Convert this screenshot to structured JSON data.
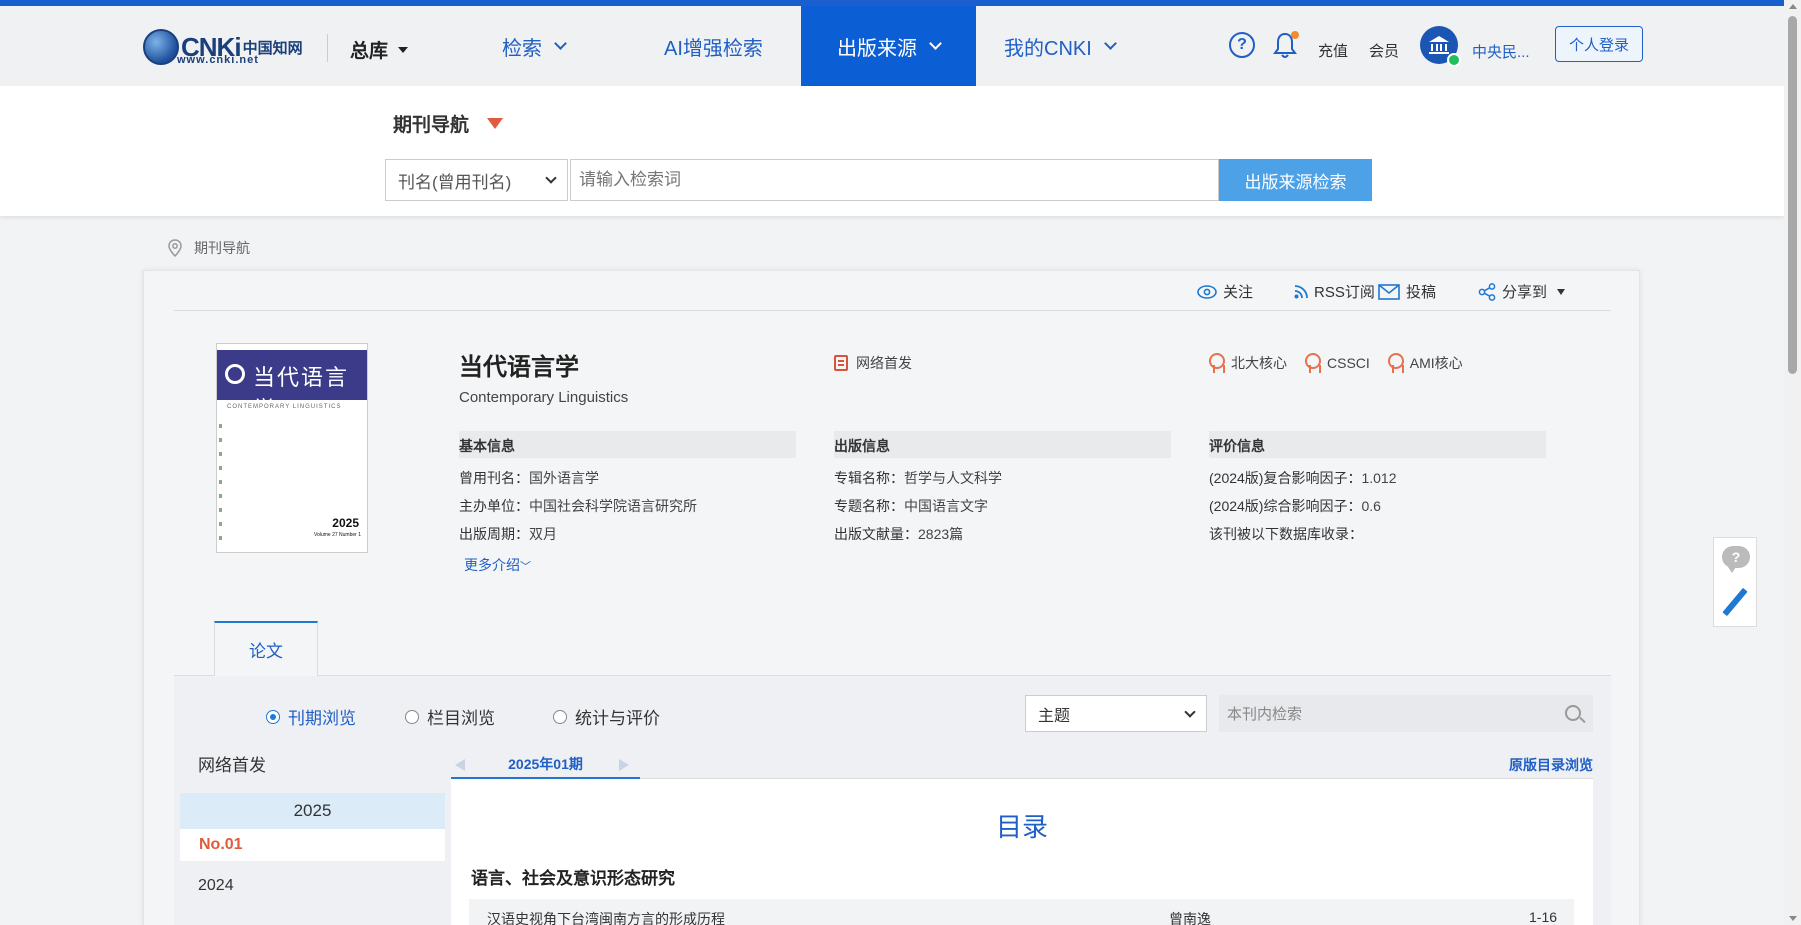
{
  "header": {
    "logo_text": "CNKi",
    "logo_cn": "中国知网",
    "logo_sub": "www.cnki.net",
    "library": "总库",
    "nav": [
      {
        "label": "检索"
      },
      {
        "label": "AI增强检索"
      },
      {
        "label": "出版来源"
      },
      {
        "label": "我的CNKI"
      }
    ],
    "recharge": "充值",
    "member": "会员",
    "institution": "中央民...",
    "login": "个人登录",
    "help_glyph": "?",
    "colors": {
      "accent": "#1a5fd0",
      "nav_active": "#0b5ed4",
      "link": "#1f5fc6",
      "highlight": "#e05a3c"
    }
  },
  "search": {
    "nav_title": "期刊导航",
    "field_select": "刊名(曾用刊名)",
    "placeholder": "请输入检索词",
    "button": "出版来源检索"
  },
  "breadcrumb": {
    "current": "期刊导航"
  },
  "toolbar": {
    "follow": "关注",
    "rss": "RSS订阅",
    "submit": "投稿",
    "share": "分享到"
  },
  "journal": {
    "title": "当代语言学",
    "title_en": "Contemporary Linguistics",
    "online_first": "网络首发",
    "badges": [
      "北大核心",
      "CSSCI",
      "AMI核心"
    ],
    "cover": {
      "title": "当代语言学",
      "sub": "CONTEMPORARY LINGUISTICS",
      "year": "2025",
      "vol": "Volume 27  Number 1"
    },
    "basic": {
      "heading": "基本信息",
      "rows": [
        {
          "label": "曾用刊名：",
          "value": "国外语言学"
        },
        {
          "label": "主办单位：",
          "value": "中国社会科学院语言研究所"
        },
        {
          "label": "出版周期：",
          "value": "双月"
        }
      ]
    },
    "publish": {
      "heading": "出版信息",
      "rows": [
        {
          "label": "专辑名称：",
          "value": "哲学与人文科学"
        },
        {
          "label": "专题名称：",
          "value": "中国语言文字"
        },
        {
          "label": "出版文献量：",
          "value": "2823篇"
        }
      ]
    },
    "eval": {
      "heading": "评价信息",
      "rows": [
        {
          "label": "(2024版)复合影响因子：",
          "value": "1.012"
        },
        {
          "label": "(2024版)综合影响因子：",
          "value": "0.6"
        },
        {
          "label": "该刊被以下数据库收录：",
          "value": ""
        }
      ]
    },
    "more": "更多介绍"
  },
  "tabs": {
    "papers": "论文"
  },
  "browse": {
    "modes": [
      {
        "label": "刊期浏览",
        "checked": true
      },
      {
        "label": "栏目浏览",
        "checked": false
      },
      {
        "label": "统计与评价",
        "checked": false
      }
    ],
    "field": "主题",
    "inner_placeholder": "本刊内检索",
    "years": {
      "online_first": "网络首发",
      "current_year": "2025",
      "current_issue": "No.01",
      "prev_year": "2024"
    },
    "issue_tab": "2025年01期",
    "orig_toc": "原版目录浏览",
    "toc": {
      "title": "目录",
      "section": "语言、社会及意识形态研究",
      "rows": [
        {
          "title": "汉语史视角下台湾闽南方言的形成历程",
          "author": "曾南逸",
          "pages": "1-16"
        }
      ]
    }
  }
}
